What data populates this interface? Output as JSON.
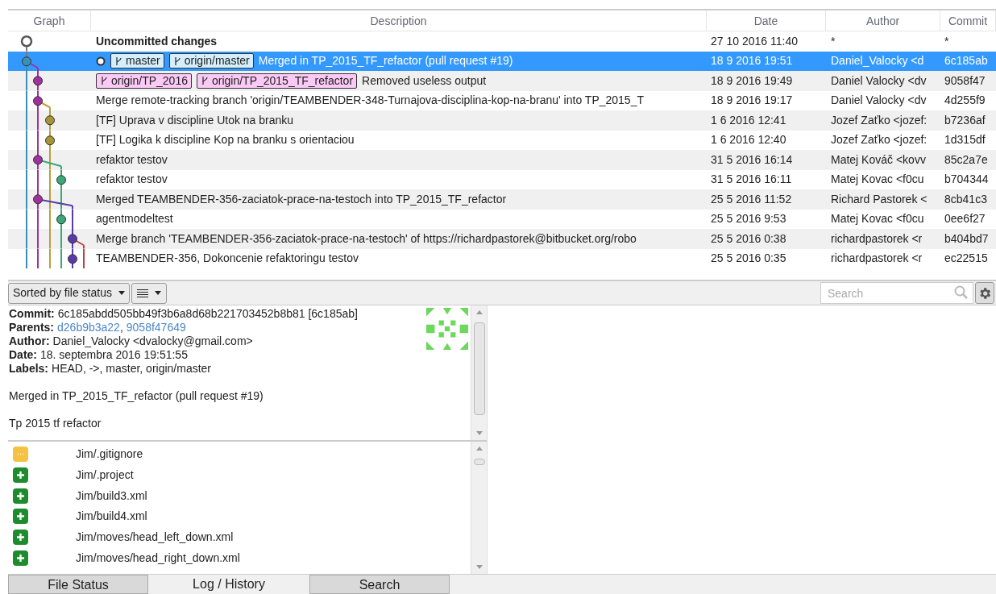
{
  "log": {
    "columns": [
      "Graph",
      "Description",
      "Date",
      "Author",
      "Commit"
    ],
    "rows": [
      {
        "description": "Uncommitted changes",
        "bold": true,
        "date": "27 10 2016 11:40",
        "author": "*",
        "commit": "*",
        "selected": false,
        "head": false,
        "color": "#ffffff",
        "refs": []
      },
      {
        "description": "Merged in TP_2015_TF_refactor (pull request #19)",
        "bold": false,
        "date": "18 9 2016 19:51",
        "author": "Daniel_Valocky <d",
        "commit": "6c185ab",
        "selected": true,
        "head": true,
        "color": "#3a8fb5",
        "refs": [
          {
            "name": "master",
            "color": "#d4eefb"
          },
          {
            "name": "origin/master",
            "color": "#d4eefb"
          }
        ]
      },
      {
        "description": "Removed useless output",
        "bold": false,
        "date": "18 9 2016 19:49",
        "author": "Daniel Valocky <dv",
        "commit": "9058f47",
        "selected": false,
        "head": false,
        "color": "#a0309e",
        "refs": [
          {
            "name": "origin/TP_2016",
            "color": "#fbc9f5"
          },
          {
            "name": "origin/TP_2015_TF_refactor",
            "color": "#fbc9f5"
          }
        ]
      },
      {
        "description": "Merge remote-tracking branch 'origin/TEAMBENDER-348-Turnajova-disciplina-kop-na-branu' into TP_2015_T",
        "bold": false,
        "date": "18 9 2016 19:17",
        "author": "Daniel Valocky <dv",
        "commit": "4d255f9",
        "selected": false,
        "head": false,
        "color": "#a0309e",
        "refs": []
      },
      {
        "description": "[TF] Uprava v discipline Utok na branku",
        "bold": false,
        "date": "1 6 2016 12:41",
        "author": "Jozef Zaťko <jozef:",
        "commit": "b7236af",
        "selected": false,
        "head": false,
        "color": "#a89438",
        "refs": []
      },
      {
        "description": "[TF] Logika k discipline Kop na branku s orientaciou",
        "bold": false,
        "date": "1 6 2016 12:40",
        "author": "Jozef Zaťko <jozef:",
        "commit": "1d315df",
        "selected": false,
        "head": false,
        "color": "#a89438",
        "refs": []
      },
      {
        "description": "refaktor testov",
        "bold": false,
        "date": "31 5 2016 16:14",
        "author": "Matej Kováč <kovv",
        "commit": "85c2a7e",
        "selected": false,
        "head": false,
        "color": "#a0309e",
        "refs": []
      },
      {
        "description": "refaktor testov",
        "bold": false,
        "date": "31 5 2016 16:11",
        "author": "Matej Kovac <f0cu",
        "commit": "b704344",
        "selected": false,
        "head": false,
        "color": "#3aa878",
        "refs": []
      },
      {
        "description": "Merged TEAMBENDER-356-zaciatok-prace-na-testoch into TP_2015_TF_refactor",
        "bold": false,
        "date": "25 5 2016 11:52",
        "author": "Richard Pastorek <",
        "commit": "8cb41c3",
        "selected": false,
        "head": false,
        "color": "#a0309e",
        "refs": []
      },
      {
        "description": "agentmodeltest",
        "bold": false,
        "date": "25 5 2016 9:53",
        "author": "Matej Kovac <f0cu",
        "commit": "0ee6f27",
        "selected": false,
        "head": false,
        "color": "#3aa878",
        "refs": []
      },
      {
        "description": "Merge branch 'TEAMBENDER-356-zaciatok-prace-na-testoch' of https://richardpastorek@bitbucket.org/robo",
        "bold": false,
        "date": "25 5 2016 0:38",
        "author": "richardpastorek <r",
        "commit": "b404bd7",
        "selected": false,
        "head": false,
        "color": "#5a3aa8",
        "refs": []
      },
      {
        "description": "TEAMBENDER-356, Dokoncenie refaktoringu testov",
        "bold": false,
        "date": "25 5 2016 0:35",
        "author": "richardpastorek <r",
        "commit": "ec22515",
        "selected": false,
        "head": false,
        "color": "#5a3aa8",
        "refs": []
      }
    ]
  },
  "toolbar": {
    "sort": "Sorted by file status",
    "search": {
      "placeholder": "Search"
    }
  },
  "details": {
    "fields": [
      {
        "label": "Commit:",
        "value": "6c185abdd505bb49f3b6a8d68b221703452b8b81 [6c185ab]"
      },
      {
        "label": "Parents:",
        "links": [
          "d26b9b3a22",
          "9058f47649"
        ],
        "separator": ","
      },
      {
        "label": "Author:",
        "value": "Daniel_Valocky <dvalocky@gmail.com>"
      },
      {
        "label": "Date:",
        "value": "18. septembra 2016 19:51:55"
      },
      {
        "label": "Labels:",
        "value": "HEAD, ->, master, origin/master"
      }
    ],
    "message": [
      "Merged in TP_2015_TF_refactor (pull request #19)",
      "Tp 2015 tf refactor"
    ]
  },
  "files": [
    {
      "path": "Jim/.gitignore",
      "kind": "modified"
    },
    {
      "path": "Jim/.project",
      "kind": "added"
    },
    {
      "path": "Jim/build3.xml",
      "kind": "added"
    },
    {
      "path": "Jim/build4.xml",
      "kind": "added"
    },
    {
      "path": "Jim/moves/head_left_down.xml",
      "kind": "added"
    },
    {
      "path": "Jim/moves/head_right_down.xml",
      "kind": "added"
    }
  ],
  "tabs": [
    {
      "label": "File Status",
      "selected": false
    },
    {
      "label": "Log / History",
      "selected": true
    },
    {
      "label": "Search",
      "selected": false
    }
  ]
}
